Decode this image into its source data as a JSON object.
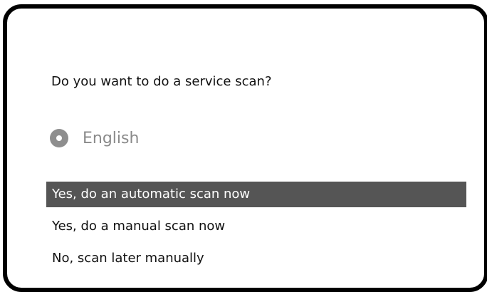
{
  "dialog": {
    "question": "Do you want to do a service scan?"
  },
  "language": {
    "label": "English",
    "icon": "radio-selected-icon"
  },
  "scan_options": [
    {
      "label": "Yes, do an automatic scan now",
      "selected": true
    },
    {
      "label": "Yes, do a manual scan now",
      "selected": false
    },
    {
      "label": "No, scan later manually",
      "selected": false
    }
  ],
  "colors": {
    "highlight": "#555555",
    "frame": "#000000",
    "muted_text": "#8a8a8a"
  }
}
